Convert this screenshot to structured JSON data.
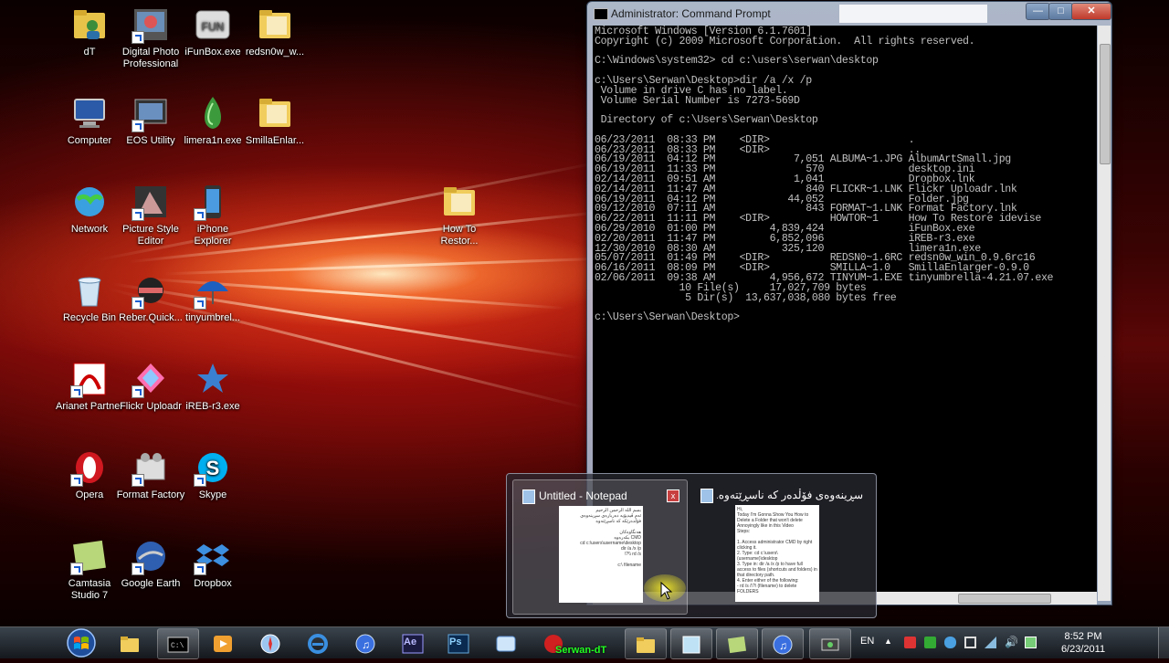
{
  "desktop_icons": [
    {
      "label": "dT",
      "icon": "user-folder-icon",
      "shortcut": false
    },
    {
      "label": "Digital Photo Professional",
      "icon": "camera-app-icon",
      "shortcut": true
    },
    {
      "label": "iFunBox.exe",
      "icon": "ifunbox-icon",
      "shortcut": false
    },
    {
      "label": "redsn0w_w...",
      "icon": "folder-icon",
      "shortcut": false
    },
    {
      "label": "Computer",
      "icon": "computer-icon",
      "shortcut": false
    },
    {
      "label": "EOS Utility",
      "icon": "eos-utility-icon",
      "shortcut": true
    },
    {
      "label": "limera1n.exe",
      "icon": "limera1n-icon",
      "shortcut": false
    },
    {
      "label": "SmillaEnlar...",
      "icon": "folder-icon",
      "shortcut": false
    },
    {
      "label": "Network",
      "icon": "network-globe-icon",
      "shortcut": false
    },
    {
      "label": "Picture Style Editor",
      "icon": "picture-style-icon",
      "shortcut": true
    },
    {
      "label": "iPhone Explorer",
      "icon": "iphone-explorer-icon",
      "shortcut": true
    },
    {
      "label": "How To Restor...",
      "icon": "folder-icon",
      "shortcut": false
    },
    {
      "label": "Recycle Bin",
      "icon": "recycle-bin-icon",
      "shortcut": false
    },
    {
      "label": "Reber.Quick...",
      "icon": "reber-quick-icon",
      "shortcut": true
    },
    {
      "label": "tinyumbrel...",
      "icon": "umbrella-icon",
      "shortcut": true
    },
    {
      "label": "Arianet Partner",
      "icon": "arianet-icon",
      "shortcut": true
    },
    {
      "label": "Flickr Uploadr",
      "icon": "flickr-icon",
      "shortcut": true
    },
    {
      "label": "iREB-r3.exe",
      "icon": "ireb-icon",
      "shortcut": false
    },
    {
      "label": "Opera",
      "icon": "opera-icon",
      "shortcut": true
    },
    {
      "label": "Format Factory",
      "icon": "format-factory-icon",
      "shortcut": true
    },
    {
      "label": "Skype",
      "icon": "skype-icon",
      "shortcut": true
    },
    {
      "label": "Camtasia Studio 7",
      "icon": "camtasia-icon",
      "shortcut": true
    },
    {
      "label": "Google Earth",
      "icon": "google-earth-icon",
      "shortcut": true
    },
    {
      "label": "Dropbox",
      "icon": "dropbox-icon",
      "shortcut": true
    }
  ],
  "cmd_window": {
    "title": "Administrator: Command Prompt",
    "lines": [
      "Microsoft Windows [Version 6.1.7601]",
      "Copyright (c) 2009 Microsoft Corporation.  All rights reserved.",
      "",
      "C:\\Windows\\system32> cd c:\\users\\serwan\\desktop",
      "",
      "c:\\Users\\Serwan\\Desktop>dir /a /x /p",
      " Volume in drive C has no label.",
      " Volume Serial Number is 7273-569D",
      "",
      " Directory of c:\\Users\\Serwan\\Desktop",
      "",
      "06/23/2011  08:33 PM    <DIR>                       .",
      "06/23/2011  08:33 PM    <DIR>                       ..",
      "06/19/2011  04:12 PM             7,051 ALBUMA~1.JPG AlbumArtSmall.jpg",
      "06/19/2011  11:33 PM               570              desktop.ini",
      "02/14/2011  09:51 AM             1,041              Dropbox.lnk",
      "02/14/2011  11:47 AM               840 FLICKR~1.LNK Flickr Uploadr.lnk",
      "06/19/2011  04:12 PM            44,052              Folder.jpg",
      "09/12/2010  07:11 AM               843 FORMAT~1.LNK Format Factory.lnk",
      "06/22/2011  11:11 PM    <DIR>          HOWTOR~1     How To Restore idevise",
      "06/29/2010  01:00 PM         4,839,424              iFunBox.exe",
      "02/20/2011  11:47 PM         6,852,096              iREB-r3.exe",
      "12/30/2010  08:30 AM           325,120              limera1n.exe",
      "05/07/2011  01:49 PM    <DIR>          REDSN0~1.6RC redsn0w_win_0.9.6rc16",
      "06/16/2011  08:09 PM    <DIR>          SMILLA~1.0   SmillaEnlarger-0.9.0",
      "02/06/2011  09:38 AM         4,956,672 TINYUM~1.EXE tinyumbrella-4.21.07.exe",
      "              10 File(s)     17,027,709 bytes",
      "               5 Dir(s)  13,637,038,080 bytes free",
      "",
      "c:\\Users\\Serwan\\Desktop>"
    ]
  },
  "thumbnails": [
    {
      "title": "Untitled - Notepad",
      "close_label": "x",
      "preview_lines": [
        "بسم الله الرحمن الرحيم",
        "ئەم ڤیدیۆیە دەربارەی سڕینەوەی",
        "فۆڵدەرێکە کە ناسڕێتەوە",
        "",
        "هەنگاوەکان",
        "CMD بکەرەوە",
        "cd c:\\users\\username\\desktop",
        "dir /a /x /p",
        "rd /s \\\\?\\",
        "",
        "c:\\ filename"
      ]
    },
    {
      "title": "سڕینەوەی فۆڵدەر کە ناسڕێتەوە.txt ...",
      "preview_lines": [
        "Hi,",
        "Today I'm Gonna Show You How to",
        "Delete a Folder that won't delete",
        "Annoyingly like in this Video",
        "Steps:",
        "",
        "1. Access administrator CMD by right",
        "clicking it.",
        "2. Type: cd c:\\users\\(username)\\desktop",
        "3. Type in: dir /a /x /p to have full",
        "access to files (shortcuts and folders) in",
        "that directory path.",
        "4. Enter either of the following:",
        "- rd /s /\\?\\ (filename) to delete",
        "FOLDERS"
      ]
    }
  ],
  "taskbar": {
    "buttons": [
      {
        "name": "explorer",
        "icon": "folder-icon",
        "open": false
      },
      {
        "name": "cmd",
        "icon": "cmd-icon",
        "open": true
      },
      {
        "name": "media",
        "icon": "media-player-icon",
        "open": false
      },
      {
        "name": "safari",
        "icon": "safari-icon",
        "open": false
      },
      {
        "name": "ie",
        "icon": "internet-explorer-icon",
        "open": false
      },
      {
        "name": "itunes",
        "icon": "itunes-icon",
        "open": false
      },
      {
        "name": "aftereffects",
        "icon": "after-effects-icon",
        "open": false
      },
      {
        "name": "photoshop",
        "icon": "photoshop-icon",
        "open": false
      },
      {
        "name": "network",
        "icon": "network-icon",
        "open": false
      },
      {
        "name": "serwan",
        "icon": "serwan-icon",
        "open": false
      },
      {
        "name": "folder2",
        "icon": "folder-icon",
        "open": true
      },
      {
        "name": "notepad",
        "icon": "notepad-icon",
        "open": true
      },
      {
        "name": "camtasia",
        "icon": "camtasia-icon",
        "open": true
      },
      {
        "name": "itunes2",
        "icon": "itunes-icon",
        "open": true
      },
      {
        "name": "recorder",
        "icon": "recorder-icon",
        "open": true
      }
    ],
    "ae_label": "Ae",
    "ps_label": "Ps",
    "serwan_label": "Serwan-dT",
    "lang": "EN",
    "time": "8:52 PM",
    "date": "6/23/2011"
  }
}
